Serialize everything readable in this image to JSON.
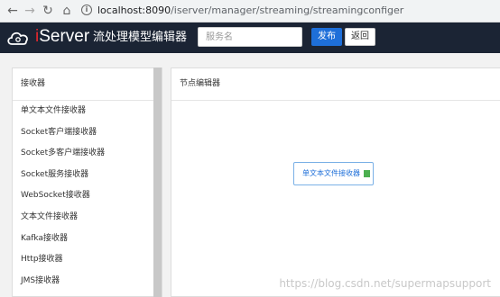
{
  "browser": {
    "url_host": "localhost:8090",
    "url_path": "/iserver/manager/streaming/streamingconfiger"
  },
  "app": {
    "logo_prefix": "i",
    "logo_name": "Server",
    "title": "流处理模型编辑器",
    "search_placeholder": "服务名",
    "publish_label": "发布",
    "back_label": "返回"
  },
  "receivers": {
    "header": "接收器",
    "items": [
      "单文本文件接收器",
      "Socket客户端接收器",
      "Socket多客户端接收器",
      "Socket服务接收器",
      "WebSocket接收器",
      "文本文件接收器",
      "Kafka接收器",
      "Http接收器",
      "JMS接收器"
    ]
  },
  "editor": {
    "header": "节点编辑器",
    "node_label": "单文本文件接收器"
  },
  "watermark": "https://blog.csdn.net/supermapsupport",
  "colors": {
    "header_bg": "#1b2434",
    "accent_blue": "#1e6fd9",
    "logo_red": "#e5272d",
    "node_handle": "#4caf50"
  }
}
